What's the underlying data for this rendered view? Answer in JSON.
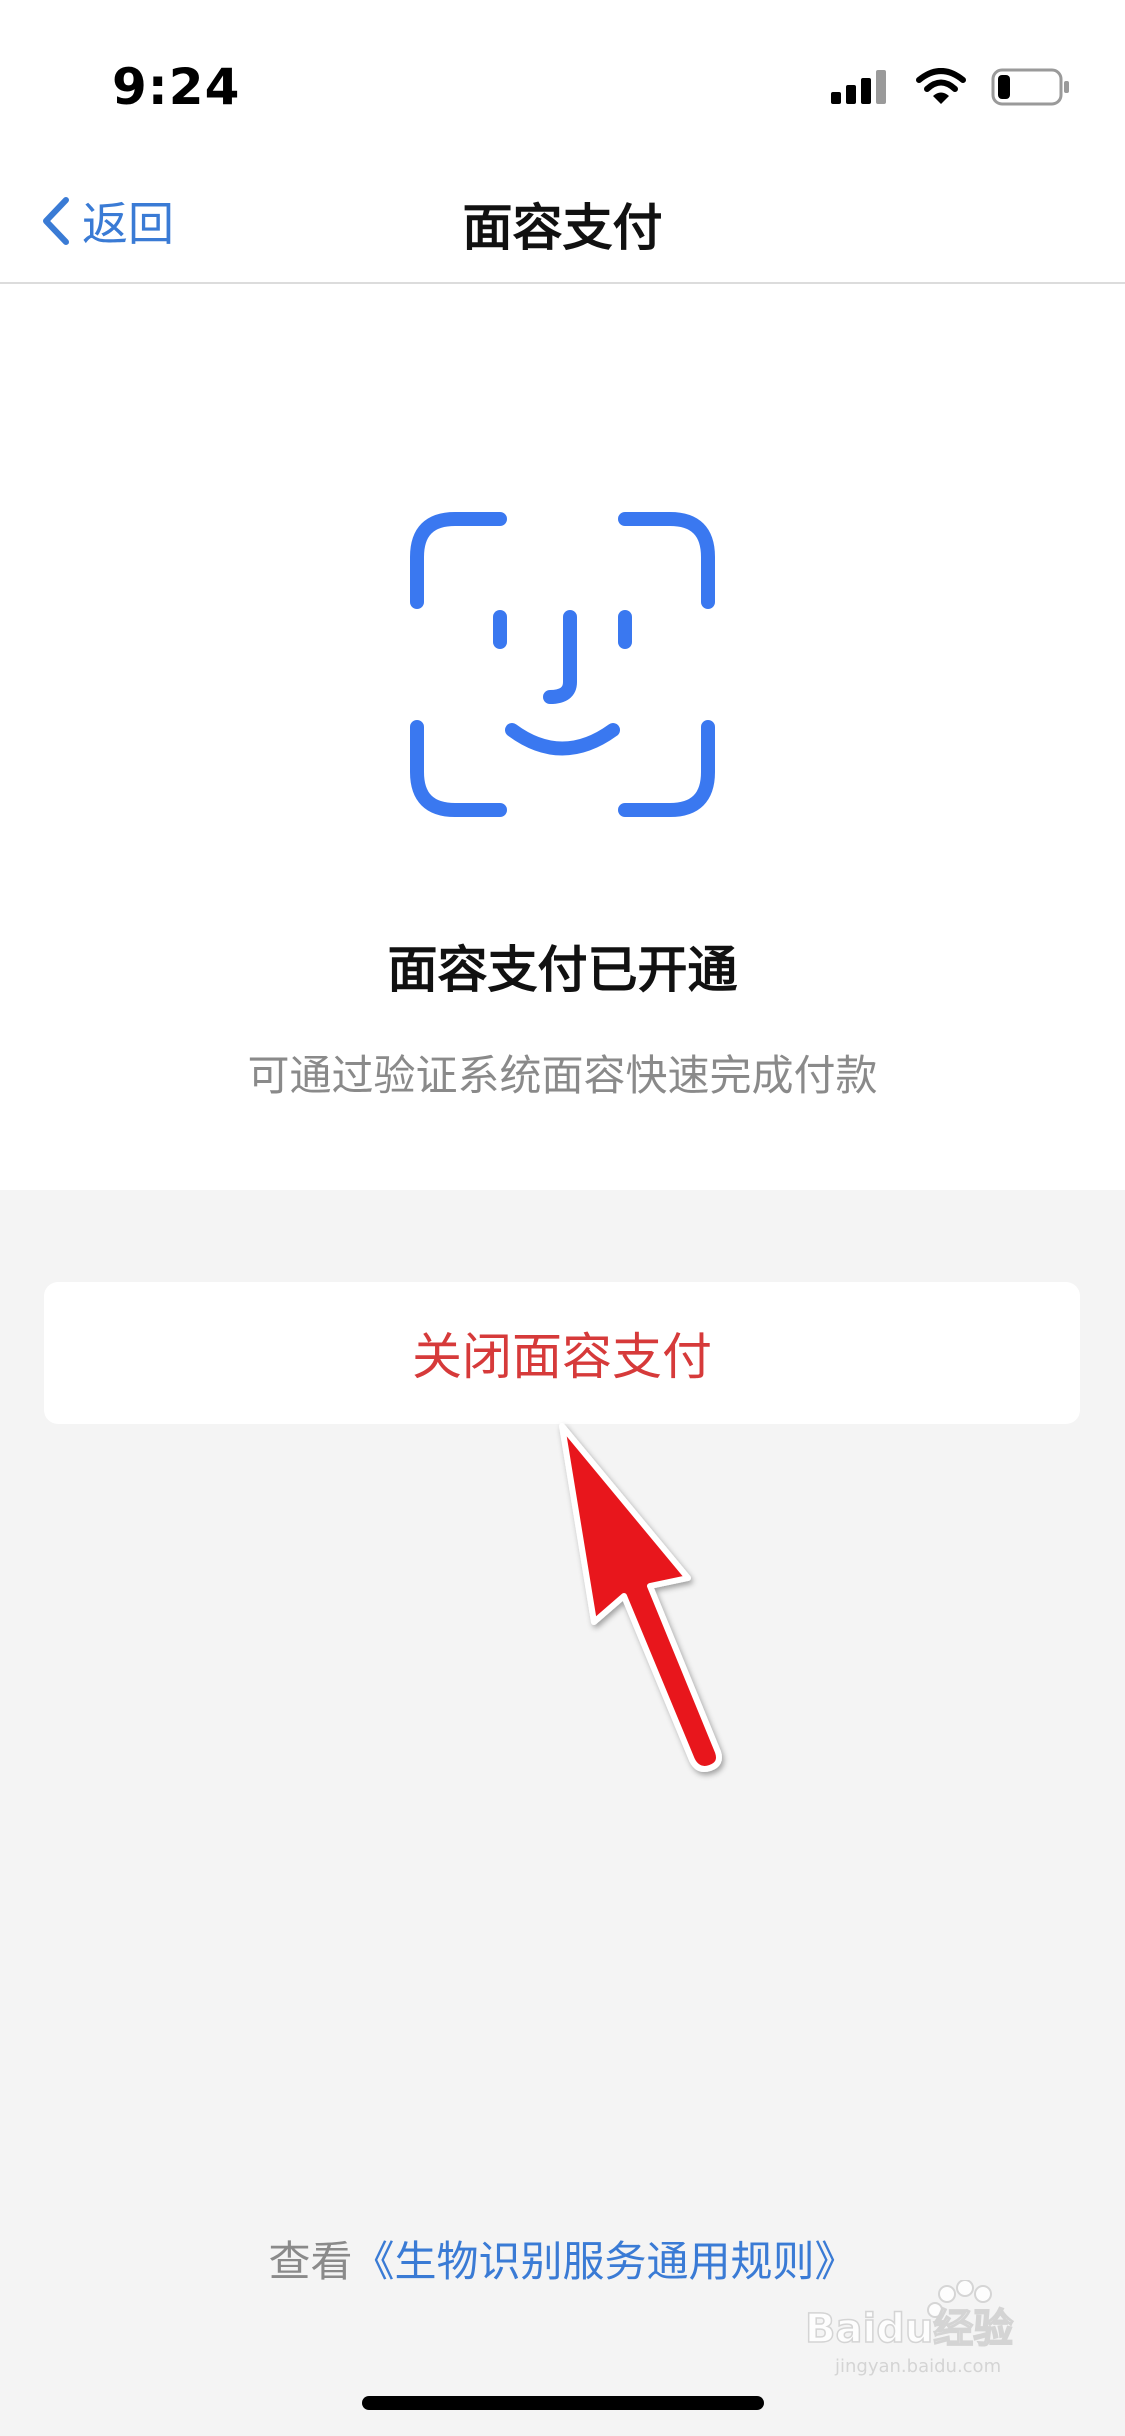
{
  "status_bar": {
    "time": "9:24"
  },
  "nav": {
    "back_label": "返回",
    "title": "面容支付"
  },
  "content": {
    "heading": "面容支付已开通",
    "description": "可通过验证系统面容快速完成付款"
  },
  "actions": {
    "disable_label": "关闭面容支付"
  },
  "footer": {
    "prefix": "查看",
    "link_label": "《生物识别服务通用规则》"
  },
  "watermark": {
    "text": "Baidu经验",
    "subtext": "jingyan.baidu.com"
  },
  "icons": {
    "back": "chevron-left-icon",
    "face": "face-id-icon",
    "signal": "cellular-signal-icon",
    "wifi": "wifi-icon",
    "battery": "battery-icon",
    "arrow": "annotation-arrow-icon"
  },
  "colors": {
    "accent_blue": "#3a7bd5",
    "face_icon_blue": "#3a78f0",
    "danger_red": "#d63a3a",
    "annotation_red": "#e8191e",
    "background_gray": "#f4f4f4"
  }
}
